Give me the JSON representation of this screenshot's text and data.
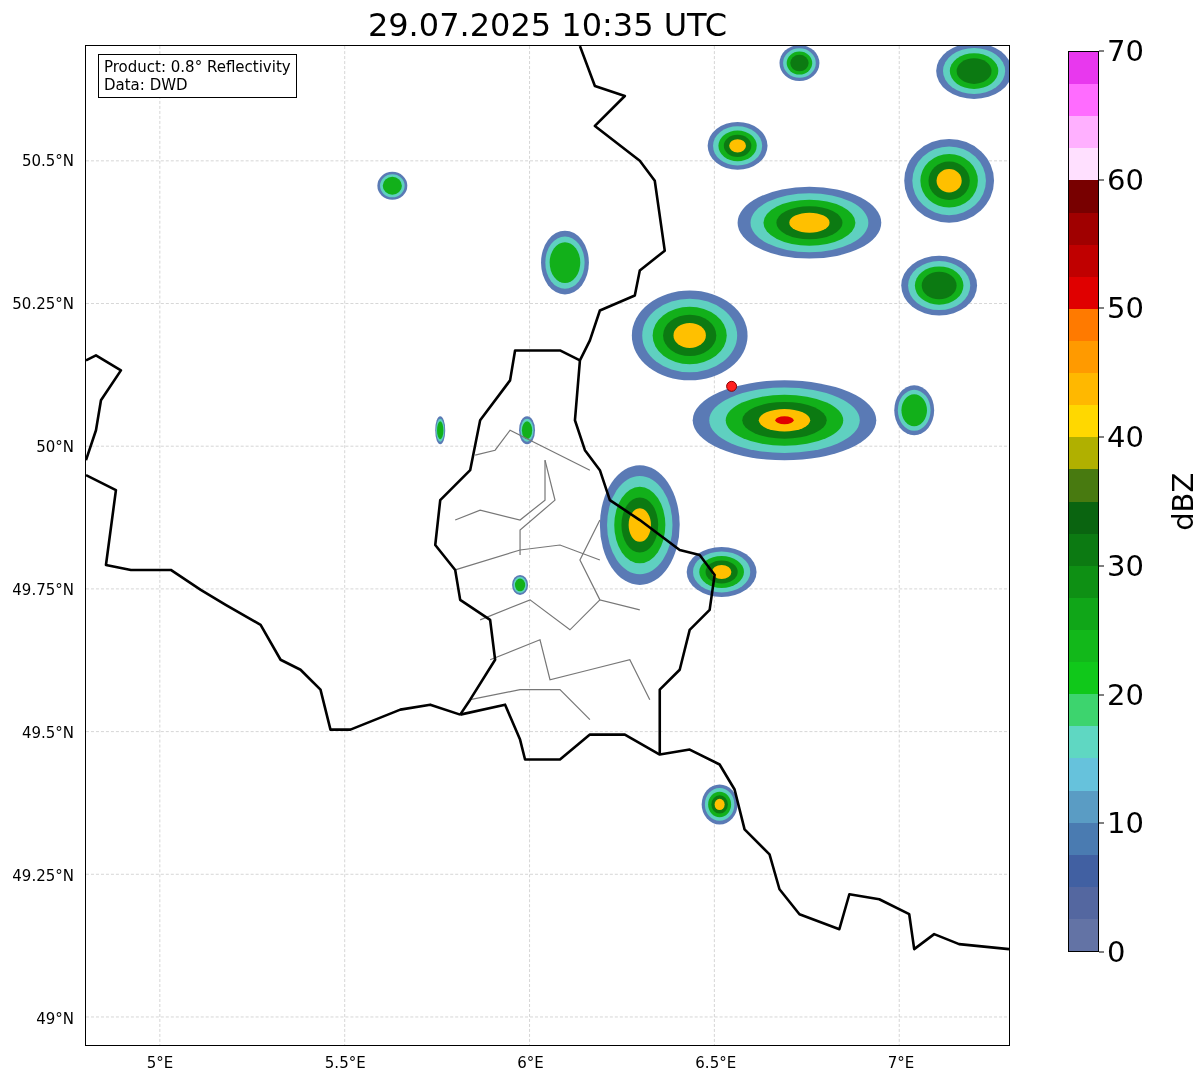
{
  "title": "29.07.2025 10:35 UTC",
  "info_box": {
    "lines": [
      "Product: 0.8° Reflectivity",
      "Data: DWD"
    ]
  },
  "map": {
    "y_ticks": [
      "50.5°N",
      "50.25°N",
      "50°N",
      "49.75°N",
      "49.5°N",
      "49.25°N",
      "49°N"
    ],
    "x_ticks": [
      "5°E",
      "5.5°E",
      "6°E",
      "6.5°E",
      "7°E"
    ]
  },
  "colorbar": {
    "label": "dBZ",
    "ticks": [
      "70",
      "60",
      "50",
      "40",
      "30",
      "20",
      "10",
      "0"
    ],
    "bands": [
      {
        "color": "#e838ee"
      },
      {
        "color": "#ff6cff"
      },
      {
        "color": "#ffb0ff"
      },
      {
        "color": "#ffe0ff"
      },
      {
        "color": "#780000"
      },
      {
        "color": "#a00000"
      },
      {
        "color": "#c00000"
      },
      {
        "color": "#e00000"
      },
      {
        "color": "#ff7a00"
      },
      {
        "color": "#ff9a00"
      },
      {
        "color": "#ffb800"
      },
      {
        "color": "#ffd800"
      },
      {
        "color": "#b0b000"
      },
      {
        "color": "#487a10"
      },
      {
        "color": "#0a6410"
      },
      {
        "color": "#0c7a12"
      },
      {
        "color": "#0e9014"
      },
      {
        "color": "#10a618"
      },
      {
        "color": "#12b81a"
      },
      {
        "color": "#10c81a"
      },
      {
        "color": "#3dd46e"
      },
      {
        "color": "#5fd7c2"
      },
      {
        "color": "#66c2dc"
      },
      {
        "color": "#5a9cc4"
      },
      {
        "color": "#4a7bb1"
      },
      {
        "color": "#4160a2"
      },
      {
        "color": "#5467a0"
      },
      {
        "color": "#6373a5"
      }
    ]
  }
}
